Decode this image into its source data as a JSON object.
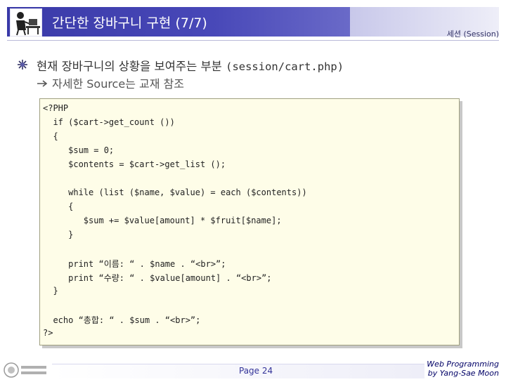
{
  "header": {
    "title": "간단한 장바구니 구현 (7/7)",
    "section": "세션 (Session)"
  },
  "body": {
    "heading": "현재 장바구니의 상황을 보여주는 부분",
    "heading_path": "(session/cart.php)",
    "subline": "자세한 Source는 교재 참조"
  },
  "code": {
    "lines": [
      "<?PHP",
      "  if ($cart->get_count ())",
      "  {",
      "     $sum = 0;",
      "     $contents = $cart->get_list ();",
      "",
      "     while (list ($name, $value) = each ($contents))",
      "     {",
      "        $sum += $value[amount] * $fruit[$name];",
      "     }",
      "",
      "     print “이름: “ . $name . “<br>”;",
      "     print “수량: “ . $value[amount] . “<br>”;",
      "  }",
      "",
      "  echo “총합: “ . $sum . “<br>”;",
      "?>"
    ]
  },
  "footer": {
    "page": "Page 24",
    "credit_line1": "Web Programming",
    "credit_line2": "by Yang-Sae Moon"
  },
  "icons": {
    "logo": "person-at-desk-icon",
    "bullet": "star-bullet-icon",
    "arrow": "right-arrow-icon",
    "footer_logo": "university-seal-icon"
  },
  "colors": {
    "title_bar": "#3a3aa8",
    "code_bg": "#fefde8",
    "page_num": "#333399"
  }
}
